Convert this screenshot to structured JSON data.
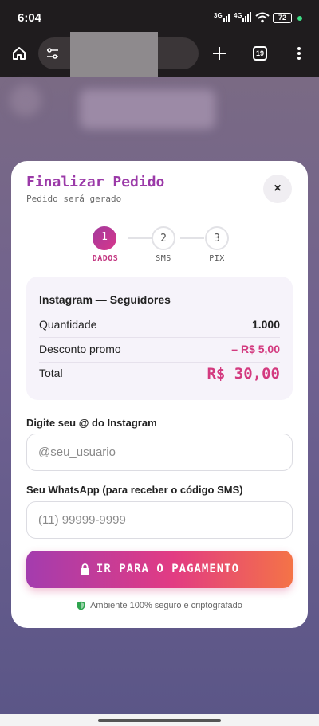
{
  "status_bar": {
    "time": "6:04",
    "network_1": "3G",
    "network_2": "4G",
    "battery": "72"
  },
  "browser": {
    "tab_count": "19",
    "icons": [
      "home-icon",
      "tune-icon",
      "new-tab-icon",
      "tabs-icon",
      "more-icon"
    ]
  },
  "modal": {
    "title": "Finalizar Pedido",
    "subtitle": "Pedido será gerado",
    "close_label": "×",
    "steps": [
      {
        "number": "1",
        "label": "DADOS"
      },
      {
        "number": "2",
        "label": "SMS"
      },
      {
        "number": "3",
        "label": "PIX"
      }
    ],
    "summary": {
      "product": "Instagram — Seguidores",
      "rows": [
        {
          "label": "Quantidade",
          "value": "1.000"
        },
        {
          "label": "Desconto promo",
          "value": "– R$ 5,00"
        }
      ],
      "total_label": "Total",
      "total_value": "R$ 30,00"
    },
    "instagram_field": {
      "label": "Digite seu @ do Instagram",
      "placeholder": "@seu_usuario",
      "value": ""
    },
    "whatsapp_field": {
      "label": "Seu WhatsApp (para receber o código SMS)",
      "placeholder": "(11) 99999-9999",
      "value": ""
    },
    "pay_button": "IR PARA O PAGAMENTO",
    "secure_note": "Ambiente 100% seguro e criptografado"
  },
  "colors": {
    "accent": "#9b3aa8",
    "accent_pink": "#d33a7f",
    "gradient_end": "#f47347",
    "secure_green": "#2ea44f"
  }
}
